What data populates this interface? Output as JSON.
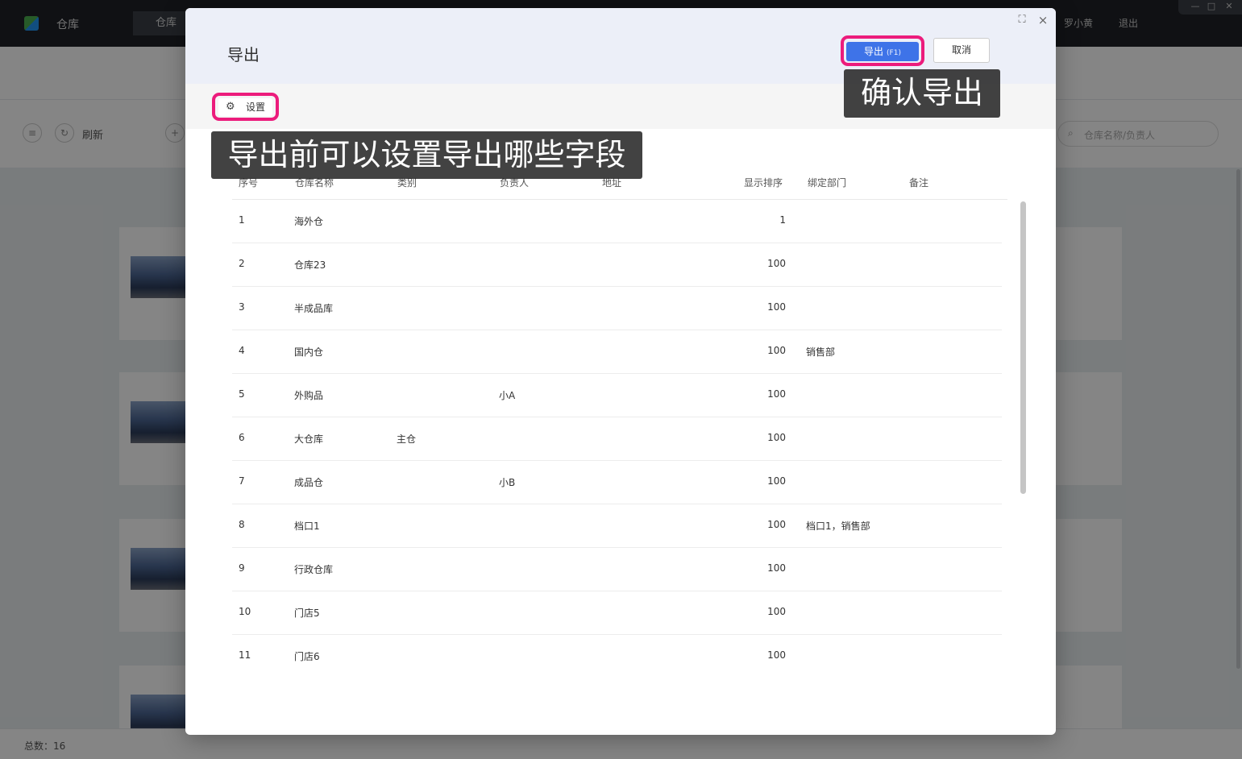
{
  "app": {
    "title": "仓库",
    "tab": "仓库",
    "user": "罗小黄",
    "logout": "退出",
    "refresh_label": "刷新",
    "search_placeholder": "仓库名称/负责人",
    "total_label": "总数：16"
  },
  "modal": {
    "title": "导出",
    "export_button": "导出",
    "export_hotkey": "(F1)",
    "cancel_button": "取消",
    "settings_button": "设置"
  },
  "table": {
    "columns": [
      "序号",
      "仓库名称",
      "类别",
      "负责人",
      "地址",
      "显示排序",
      "绑定部门",
      "备注"
    ],
    "rows": [
      {
        "no": "1",
        "name": "海外仓",
        "category": "",
        "manager": "",
        "address": "",
        "order": "1",
        "dept": "",
        "note": ""
      },
      {
        "no": "2",
        "name": "仓库23",
        "category": "",
        "manager": "",
        "address": "",
        "order": "100",
        "dept": "",
        "note": ""
      },
      {
        "no": "3",
        "name": "半成品库",
        "category": "",
        "manager": "",
        "address": "",
        "order": "100",
        "dept": "",
        "note": ""
      },
      {
        "no": "4",
        "name": "国内仓",
        "category": "",
        "manager": "",
        "address": "",
        "order": "100",
        "dept": "销售部",
        "note": ""
      },
      {
        "no": "5",
        "name": "外购品",
        "category": "",
        "manager": "小A",
        "address": "",
        "order": "100",
        "dept": "",
        "note": ""
      },
      {
        "no": "6",
        "name": "大仓库",
        "category": "主仓",
        "manager": "",
        "address": "",
        "order": "100",
        "dept": "",
        "note": ""
      },
      {
        "no": "7",
        "name": "成品仓",
        "category": "",
        "manager": "小B",
        "address": "",
        "order": "100",
        "dept": "",
        "note": ""
      },
      {
        "no": "8",
        "name": "档口1",
        "category": "",
        "manager": "",
        "address": "",
        "order": "100",
        "dept": "档口1，销售部",
        "note": ""
      },
      {
        "no": "9",
        "name": "行政仓库",
        "category": "",
        "manager": "",
        "address": "",
        "order": "100",
        "dept": "",
        "note": ""
      },
      {
        "no": "10",
        "name": "门店5",
        "category": "",
        "manager": "",
        "address": "",
        "order": "100",
        "dept": "",
        "note": ""
      },
      {
        "no": "11",
        "name": "门店6",
        "category": "",
        "manager": "",
        "address": "",
        "order": "100",
        "dept": "",
        "note": ""
      }
    ]
  },
  "annotations": {
    "confirm_export": "确认导出",
    "settings_hint": "导出前可以设置导出哪些字段"
  },
  "colors": {
    "highlight": "#ec1c7c",
    "primary": "#3e73e8"
  },
  "icons": [
    "logo-icon",
    "minimize-icon",
    "maximize-icon",
    "window-close-icon",
    "expand-icon",
    "close-icon",
    "gear-icon",
    "search-icon",
    "refresh-icon"
  ]
}
